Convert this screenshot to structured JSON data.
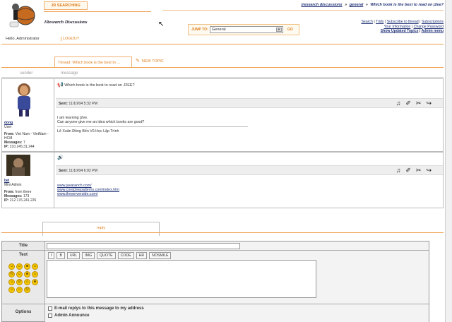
{
  "header": {
    "site_tab": "JR SEARCHING",
    "site_name": "JResearch Discussions",
    "breadcrumb": [
      "jresearch discussions",
      "general",
      "Which book is the best to read on j2ee?"
    ],
    "breadcrumb_sep": "»",
    "jump_label": "JUMP TO:",
    "jump_value": "General",
    "jump_go": "GO",
    "links_row1": [
      "Search",
      "Trids",
      "Subscribe to thread",
      "Subscriptions"
    ],
    "links_row2": [
      "Your Information",
      "Change Password"
    ],
    "links_row3": [
      "Show Updated Topics",
      "Admin menu"
    ],
    "greeting": "Hello, Administrator",
    "logout": "LOGOUT"
  },
  "thread": {
    "tab_title": "Thread: Which book is the best to ...",
    "new_topic": "NEW TOPIC",
    "col_sender": "sender",
    "col_message": "message"
  },
  "posts": [
    {
      "author": "dong",
      "role": "User",
      "from_label": "From:",
      "from": "Viet Nam - VietNam - HCM",
      "messages_label": "Messages:",
      "messages": "7",
      "ip_label": "IP:",
      "ip": "210.245.31.244",
      "subject": "Which book is the best to read on J2EE?",
      "sent_label": "Sent:",
      "sent": "11/10/04 5:32 PM",
      "body": [
        "I am learning j2ee.",
        "Can anyone give me an idea which books are good?"
      ],
      "signature": "Lê Xuân Đồng Bến Vũ Học Lập Trình"
    },
    {
      "author": "bel",
      "role": "Mini Admin",
      "from_label": "From:",
      "from": "from there",
      "messages_label": "Messages:",
      "messages": "173",
      "ip_label": "IP:",
      "ip": "212.176.241.226",
      "sent_label": "Sent:",
      "sent": "11/10/04 6:02 PM",
      "links": [
        "www.javaranch.com/",
        "www.corej2eepatterns.com/index.htm",
        "www.theserverside.com/"
      ]
    }
  ],
  "reply": {
    "tab": "reply",
    "title_label": "Title",
    "text_label": "Text",
    "options_label": "Options",
    "toolbar": [
      "I",
      "B",
      "URL",
      "IMG",
      "QUOTE",
      "CODE",
      "HR",
      "NOSMILE"
    ],
    "option1": "E-mail replys to this message to my address",
    "option2": "Admin Announce"
  },
  "colors": {
    "accent": "#e08020",
    "line": "#f0a050"
  }
}
